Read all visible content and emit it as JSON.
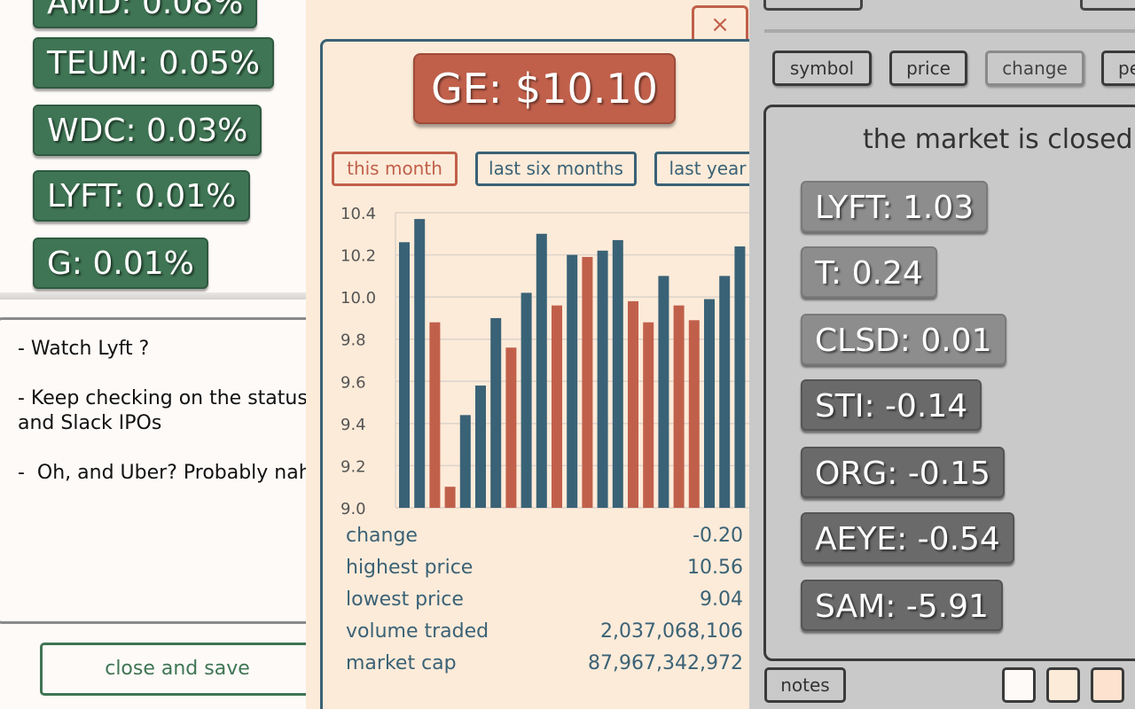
{
  "left_panel": {
    "gainers": [
      {
        "label": "AMD: 0.08%"
      },
      {
        "label": "TEUM: 0.05%"
      },
      {
        "label": "WDC: 0.03%"
      },
      {
        "label": "LYFT: 0.01%"
      },
      {
        "label": "G: 0.01%"
      }
    ],
    "notes_text": "- Watch Lyft ?\n\n- Keep checking on the status of Pinterest\nand Slack IPOs\n\n-  Oh, and Uber? Probably nah",
    "close_save_label": "close and save"
  },
  "modal": {
    "close_label": "×",
    "ticker_price": "GE: $10.10",
    "ranges": [
      "this month",
      "last six months",
      "last year"
    ],
    "active_range": "this month",
    "stats": [
      {
        "label": "change",
        "value": "-0.20"
      },
      {
        "label": "highest price",
        "value": "10.56"
      },
      {
        "label": "lowest price",
        "value": "9.04"
      },
      {
        "label": "volume traded",
        "value": "2,037,068,106"
      },
      {
        "label": "market cap",
        "value": "87,967,342,972"
      }
    ]
  },
  "chart_data": {
    "type": "bar",
    "ylim": [
      9.0,
      10.4
    ],
    "yticks": [
      "10.4",
      "10.2",
      "10.0",
      "9.8",
      "9.6",
      "9.4",
      "9.2",
      "9.0"
    ],
    "grid": true,
    "colors": {
      "up": "#3a6276",
      "down": "#c0604b"
    },
    "values": [
      10.26,
      10.37,
      9.88,
      9.1,
      9.44,
      9.58,
      9.9,
      9.76,
      10.02,
      10.3,
      9.96,
      10.2,
      10.19,
      10.22,
      10.27,
      9.98,
      9.88,
      10.1,
      9.96,
      9.89,
      9.99,
      10.1,
      10.24
    ],
    "directions": [
      "up",
      "up",
      "down",
      "down",
      "up",
      "up",
      "up",
      "down",
      "up",
      "up",
      "down",
      "up",
      "down",
      "up",
      "up",
      "down",
      "down",
      "up",
      "down",
      "down",
      "up",
      "up",
      "up"
    ]
  },
  "right_panel": {
    "sort_buttons": [
      "symbol",
      "price",
      "change",
      "percent"
    ],
    "active_sort": "change",
    "market_status": "the market is closed",
    "tickers": [
      {
        "label": "LYFT: 1.03",
        "color": "#8d8d8d"
      },
      {
        "label": "T: 0.24",
        "color": "#8d8d8d"
      },
      {
        "label": "CLSD: 0.01",
        "color": "#8d8d8d"
      },
      {
        "label": "STI: -0.14",
        "color": "#6a6a6a"
      },
      {
        "label": "ORG: -0.15",
        "color": "#6a6a6a"
      },
      {
        "label": "AEYE: -0.54",
        "color": "#6a6a6a"
      },
      {
        "label": "SAM: -5.91",
        "color": "#6a6a6a"
      }
    ],
    "notes_label": "notes",
    "theme_swatches": [
      "#fdfaf8",
      "#fdebd9",
      "#fde3cf"
    ]
  }
}
